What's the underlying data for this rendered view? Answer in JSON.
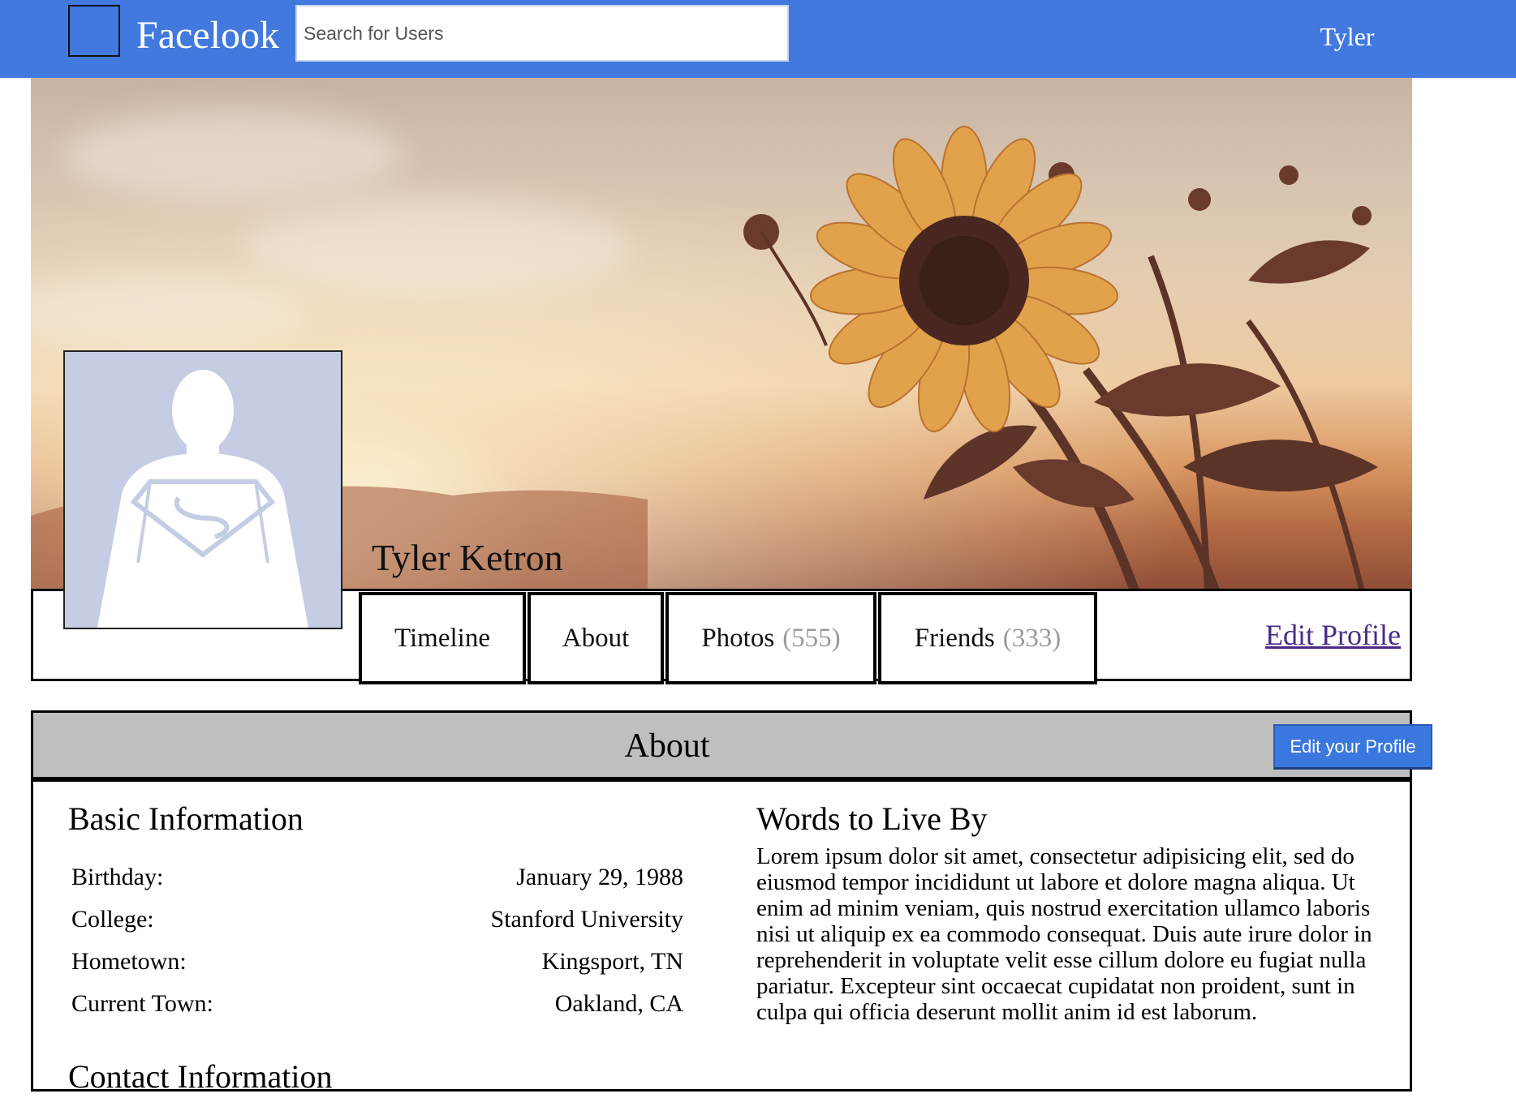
{
  "header": {
    "brand": "Facelook",
    "search_placeholder": "Search for Users",
    "user_name": "Tyler"
  },
  "profile": {
    "name": "Tyler Ketron",
    "tabs": [
      {
        "label": "Timeline",
        "count": ""
      },
      {
        "label": "About",
        "count": ""
      },
      {
        "label": "Photos",
        "count": "(555)"
      },
      {
        "label": "Friends",
        "count": "(333)"
      }
    ],
    "edit_profile_label": "Edit Profile"
  },
  "about": {
    "title": "About",
    "edit_button_label": "Edit your Profile",
    "basic_title": "Basic Information",
    "basic_rows": [
      {
        "label": "Birthday:",
        "value": "January 29, 1988"
      },
      {
        "label": "College:",
        "value": "Stanford University"
      },
      {
        "label": "Hometown:",
        "value": "Kingsport, TN"
      },
      {
        "label": "Current Town:",
        "value": "Oakland, CA"
      }
    ],
    "contact_title": "Contact Information",
    "words_title": "Words to Live By",
    "words_body": "Lorem ipsum dolor sit amet, consectetur adipisicing elit, sed do eiusmod tempor incididunt ut labore et dolore magna aliqua. Ut enim ad minim veniam, quis nostrud exercitation ullamco laboris nisi ut aliquip ex ea commodo consequat. Duis aute irure dolor in reprehenderit in voluptate velit esse cillum dolore eu fugiat nulla pariatur. Excepteur sint occaecat cupidatat non proident, sunt in culpa qui officia deserunt mollit anim id est laborum."
  },
  "colors": {
    "header_bg": "#4279df",
    "about_header_bg": "#bfbfbf",
    "button_bg": "#3a78df",
    "count_text": "#9a9a9a",
    "link_text": "#4b2a8a",
    "avatar_bg": "#c5cde4"
  }
}
